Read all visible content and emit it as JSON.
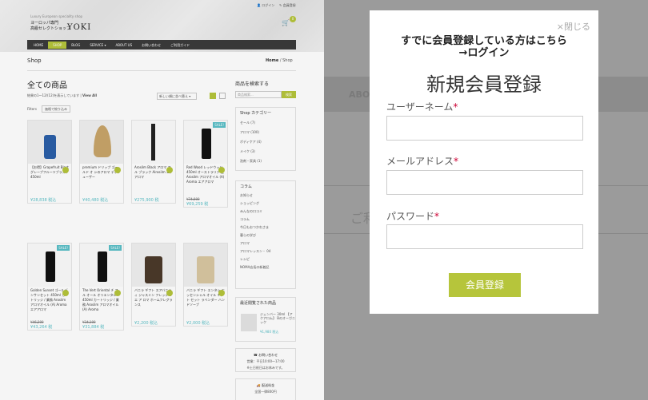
{
  "shop": {
    "tagline": "Luxury European speciality shop",
    "logo_line1": "ヨーロッパ専門",
    "logo_line2": "高級セレクトショップ",
    "logo_mark": "YOKI",
    "login_link": "ログイン",
    "register_link": "会員登録",
    "cart_count": "0",
    "nav": [
      "HOME",
      "SHOP",
      "BLOG",
      "SERVICE ▾",
      "ABOUT US",
      "お問い合わせ",
      "ご利用ガイド"
    ],
    "nav_active": 1,
    "page_title": "Shop",
    "breadcrumb_home": "Home",
    "breadcrumb_current": "Shop",
    "heading": "全ての商品",
    "result_text": "結果の1～12/(12)を表示しています",
    "view_all": "View All",
    "sort_label": "新しい順に並べ替え",
    "filter_label": "Filters",
    "filter_button": "価格で絞り込み",
    "products": [
      {
        "name": "【お得】Grapefruit Blast グレープフルーツブラスト 450ml",
        "price": "¥28,838 税込",
        "old": "",
        "sale": false,
        "img": "blue"
      },
      {
        "name": "premium ドリップ ゴールド オ シのアロマ ディフューザー",
        "price": "¥40,480 税込",
        "old": "",
        "sale": false,
        "img": "cone"
      },
      {
        "name": "Arosilm Black アロマ フル ブラック Airosilm エアアロマ",
        "price": "¥275,900 税",
        "old": "",
        "sale": false,
        "img": "stick"
      },
      {
        "name": "Red Wood レッドウッド 450ml オーストラリア 産 Arosilm アロマオイル (A) Aroma エアアロマ",
        "price": "¥69,259 税",
        "old": "¥74,800",
        "sale": true,
        "img": "bottle"
      },
      {
        "name": "Golden Sunset ゴールデンサンセット 450ml カートリッジ / 業務 Arosilm アロマオイル (A) Aroma エアアロマ",
        "price": "¥43,264 税",
        "old": "¥46,200",
        "sale": true,
        "img": "bottle"
      },
      {
        "name": "The Vert Oriental チ フル オール オリエンタル 450ml カートリッジ / 業務 Arosilm アロマオイル (A) Aroma",
        "price": "¥31,884 税",
        "old": "¥34,100",
        "sale": true,
        "img": "bottle"
      },
      {
        "name": "バニラ ギフト スアバニティ ジャスミン フレッシュ エ ア ロマ ホームフレグランス",
        "price": "¥2,200 税込",
        "old": "",
        "sale": false,
        "img": "jar"
      },
      {
        "name": "バニラ ギフト エンタシ エッセンシャル オイル ギフト セット ラベンダー ハンドソープ",
        "price": "¥2,000 税込",
        "old": "",
        "sale": false,
        "img": "jarlight"
      }
    ],
    "search_label": "商品を検索する",
    "search_placeholder": "商品検索...",
    "search_button": "検索",
    "cat_title": "Shop カテゴリー",
    "categories": [
      "セール (7)",
      "アロマ (100)",
      "ボディケア (4)",
      "メイク (3)",
      "洗剤・家具 (1)"
    ],
    "column_title": "コラム",
    "column_items": [
      "お知らせ",
      "ショッピング",
      "みんなの口コミ",
      "コラム",
      "今日もおつかれさま",
      "暮らの学び",
      "アロマ",
      "アロマレッスン・ 04",
      "レシピ",
      "NOMA店長の新着記"
    ],
    "recent_title": "最近閲覧された商品",
    "recent_item": "ジェンバー 30ml 【アクアロム】 Bのオーガニック",
    "recent_price": "¥1,980 税込",
    "contact_title": "お問い合わせ",
    "contact_hours": "営業：平日10:00〜17:00",
    "contact_note": "※土日祝日はお休みです。",
    "shipping_title": "配送料金",
    "shipping_text": "全国一律800円"
  },
  "background": {
    "nav_label": "ABOU",
    "ghost_text": "ご利"
  },
  "modal": {
    "close": "×閉じる",
    "already_line1": "すでに会員登録している方はこちら",
    "already_line2": "→ログイン",
    "title": "新規会員登録",
    "username_label": "ユーザーネーム",
    "email_label": "メールアドレス",
    "password_label": "パスワード",
    "required_mark": "*",
    "username_value": "",
    "email_value": "",
    "password_value": "",
    "submit": "会員登録"
  },
  "colors": {
    "accent": "#b6c53b",
    "price": "#5bc0c8",
    "overlay": "#9b9b9b"
  }
}
